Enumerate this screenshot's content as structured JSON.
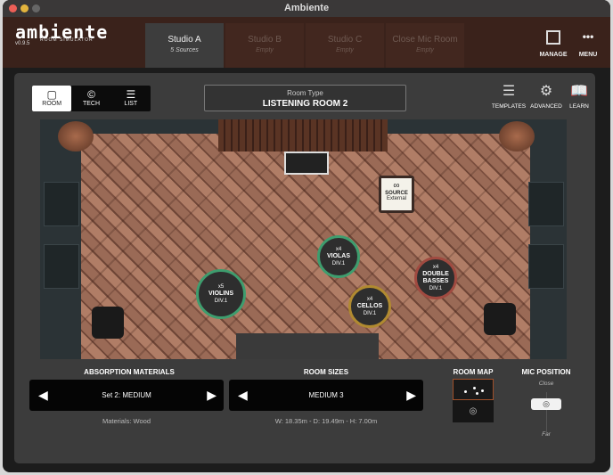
{
  "window": {
    "title": "Ambiente"
  },
  "header": {
    "logo": "ambiente",
    "logo_sub": "ROOM SIMULATOR",
    "version": "v0.9.5",
    "tabs": [
      {
        "label": "Studio A",
        "sub": "5 Sources"
      },
      {
        "label": "Studio B",
        "sub": "Empty"
      },
      {
        "label": "Studio C",
        "sub": "Empty"
      },
      {
        "label": "Close Mic Room",
        "sub": "Empty"
      }
    ],
    "manage": "MANAGE",
    "menu": "MENU"
  },
  "toolbar": {
    "views": [
      {
        "label": "ROOM",
        "icon": "room-icon"
      },
      {
        "label": "TECH",
        "icon": "tech-icon"
      },
      {
        "label": "LIST",
        "icon": "list-icon"
      }
    ],
    "room_type_label": "Room Type",
    "room_type_value": "LISTENING ROOM 2",
    "templates": "TEMPLATES",
    "advanced": "ADVANCED",
    "learn": "LEARN"
  },
  "sources": [
    {
      "count": "x5",
      "name": "VIOLINS",
      "div": "DIV.1",
      "color": "#3e9d6e"
    },
    {
      "count": "x4",
      "name": "VIOLAS",
      "div": "DIV.1",
      "color": "#3e9d6e"
    },
    {
      "count": "x4",
      "name": "CELLOS",
      "div": "DIV.1",
      "color": "#b08a30"
    },
    {
      "count": "x4",
      "name": "DOUBLE BASSES",
      "div": "DIV.1",
      "color": "#a04a40"
    }
  ],
  "source_box": {
    "title": "SOURCE",
    "sub": "External"
  },
  "bottom": {
    "absorption_label": "ABSORPTION MATERIALS",
    "absorption_value": "Set 2: MEDIUM",
    "materials": "Materials: Wood",
    "sizes_label": "ROOM SIZES",
    "sizes_value": "MEDIUM 3",
    "dimensions": "W: 18.35m - D: 19.49m - H: 7.00m",
    "map_label": "ROOM MAP",
    "mic_label": "MIC POSITION",
    "mic_close": "Close",
    "mic_far": "Far"
  }
}
